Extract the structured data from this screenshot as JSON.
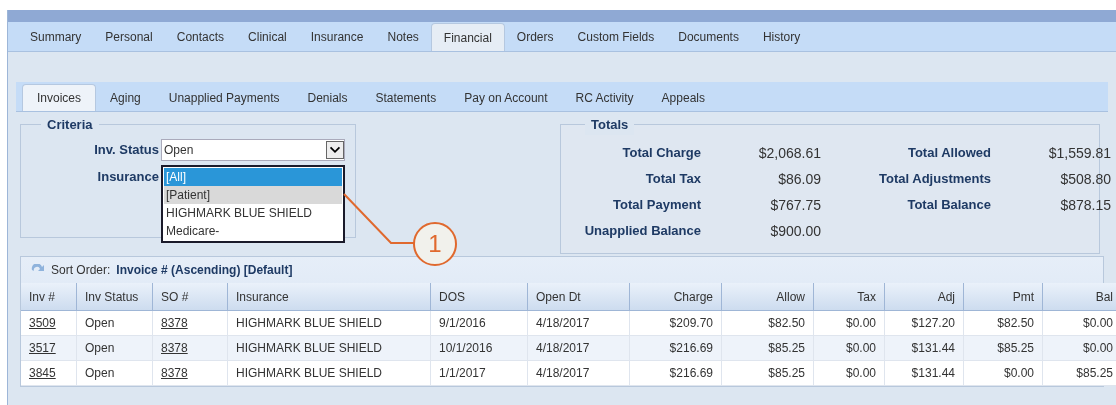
{
  "main_tabs": [
    {
      "label": "Summary",
      "selected": false
    },
    {
      "label": "Personal",
      "selected": false
    },
    {
      "label": "Contacts",
      "selected": false
    },
    {
      "label": "Clinical",
      "selected": false
    },
    {
      "label": "Insurance",
      "selected": false
    },
    {
      "label": "Notes",
      "selected": false
    },
    {
      "label": "Financial",
      "selected": true
    },
    {
      "label": "Orders",
      "selected": false
    },
    {
      "label": "Custom Fields",
      "selected": false
    },
    {
      "label": "Documents",
      "selected": false
    },
    {
      "label": "History",
      "selected": false
    }
  ],
  "sub_tabs": [
    {
      "label": "Invoices",
      "selected": true
    },
    {
      "label": "Aging",
      "selected": false
    },
    {
      "label": "Unapplied Payments",
      "selected": false
    },
    {
      "label": "Denials",
      "selected": false
    },
    {
      "label": "Statements",
      "selected": false
    },
    {
      "label": "Pay on Account",
      "selected": false
    },
    {
      "label": "RC Activity",
      "selected": false
    },
    {
      "label": "Appeals",
      "selected": false
    }
  ],
  "criteria": {
    "title": "Criteria",
    "inv_status": {
      "label": "Inv. Status",
      "value": "Open"
    },
    "insurance": {
      "label": "Insurance",
      "options": [
        {
          "label": "[All]",
          "selected": true,
          "hovered": false
        },
        {
          "label": "[Patient]",
          "selected": false,
          "hovered": true
        },
        {
          "label": "HIGHMARK BLUE SHIELD",
          "selected": false,
          "hovered": false
        },
        {
          "label": "Medicare-",
          "selected": false,
          "hovered": false
        }
      ]
    }
  },
  "callout": {
    "number": "1"
  },
  "totals": {
    "title": "Totals",
    "items": [
      {
        "label": "Total Charge",
        "value": "$2,068.61"
      },
      {
        "label": "Total Allowed",
        "value": "$1,559.81"
      },
      {
        "label": "Total Tax",
        "value": "$86.09"
      },
      {
        "label": "Total Adjustments",
        "value": "$508.80"
      },
      {
        "label": "Total Payment",
        "value": "$767.75"
      },
      {
        "label": "Total Balance",
        "value": "$878.15"
      },
      {
        "label": "Unapplied Balance",
        "value": "$900.00"
      }
    ]
  },
  "sort": {
    "label": "Sort Order:",
    "value": "Invoice # (Ascending) [Default]"
  },
  "table": {
    "columns": [
      {
        "label": "Inv #",
        "kind": "link"
      },
      {
        "label": "Inv Status",
        "kind": "text"
      },
      {
        "label": "SO #",
        "kind": "link"
      },
      {
        "label": "Insurance",
        "kind": "text"
      },
      {
        "label": "DOS",
        "kind": "text"
      },
      {
        "label": "Open Dt",
        "kind": "text"
      },
      {
        "label": "Charge",
        "kind": "money"
      },
      {
        "label": "Allow",
        "kind": "money"
      },
      {
        "label": "Tax",
        "kind": "money"
      },
      {
        "label": "Adj",
        "kind": "money"
      },
      {
        "label": "Pmt",
        "kind": "money"
      },
      {
        "label": "Bal",
        "kind": "money"
      }
    ],
    "rows": [
      [
        "3509",
        "Open",
        "8378",
        "HIGHMARK BLUE SHIELD",
        "9/1/2016",
        "4/18/2017",
        "$209.70",
        "$82.50",
        "$0.00",
        "$127.20",
        "$82.50",
        "$0.00"
      ],
      [
        "3517",
        "Open",
        "8378",
        "HIGHMARK BLUE SHIELD",
        "10/1/2016",
        "4/18/2017",
        "$216.69",
        "$85.25",
        "$0.00",
        "$131.44",
        "$85.25",
        "$0.00"
      ],
      [
        "3845",
        "Open",
        "8378",
        "HIGHMARK BLUE SHIELD",
        "1/1/2017",
        "4/18/2017",
        "$216.69",
        "$85.25",
        "$0.00",
        "$131.44",
        "$0.00",
        "$85.25"
      ]
    ]
  }
}
